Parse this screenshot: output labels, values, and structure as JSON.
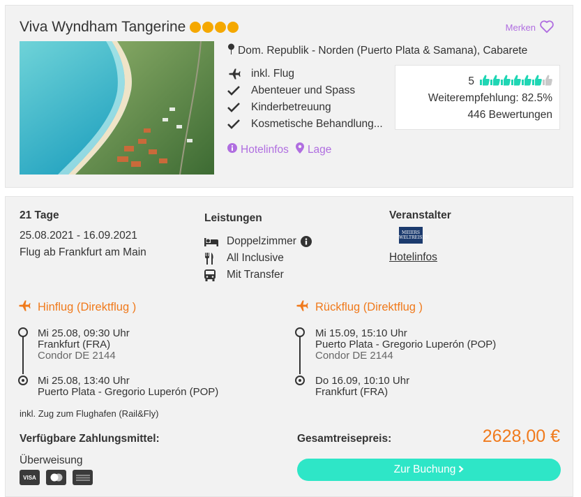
{
  "hotel": {
    "name": "Viva Wyndham Tangerine",
    "stars": 4,
    "merken_label": "Merken",
    "location": "Dom. Republik - Norden (Puerto Plata & Samana), Cabarete",
    "features": [
      {
        "icon": "plane-icon",
        "label": "inkl. Flug"
      },
      {
        "icon": "check-icon",
        "label": "Abenteuer und Spass"
      },
      {
        "icon": "check-icon",
        "label": "Kinderbetreuung"
      },
      {
        "icon": "check-icon",
        "label": "Kosmetische Behandlung..."
      }
    ],
    "rating": {
      "score": "5",
      "thumbs_filled": 6,
      "thumbs_total": 7,
      "recommend": "Weiterempfehlung: 82.5%",
      "reviews": "446 Bewertungen"
    },
    "links": {
      "hotelinfos": "Hotelinfos",
      "lage": "Lage"
    }
  },
  "trip": {
    "duration": "21 Tage",
    "dates": "25.08.2021 - 16.09.2021",
    "departure": "Flug ab Frankfurt am Main",
    "leistungen_label": "Leistungen",
    "leistungen": [
      {
        "icon": "bed-icon",
        "label": "Doppelzimmer"
      },
      {
        "icon": "cutlery-icon",
        "label": "All Inclusive"
      },
      {
        "icon": "bus-icon",
        "label": "Mit Transfer"
      }
    ],
    "veranstalter_label": "Veranstalter",
    "veranstalter_logo_text": "MEIERS WELTREISEN",
    "veranstalter_link": "Hotelinfos"
  },
  "hinflug": {
    "title": "Hinflug (Direktflug )",
    "dep_time": "Mi 25.08, 09:30 Uhr",
    "dep_airport": "Frankfurt (FRA)",
    "carrier": "Condor DE 2144",
    "arr_time": "Mi 25.08, 13:40 Uhr",
    "arr_airport": "Puerto Plata - Gregorio Luperón (POP)"
  },
  "rueckflug": {
    "title": "Rückflug (Direktflug )",
    "dep_time": "Mi 15.09, 15:10 Uhr",
    "dep_airport": "Puerto Plata - Gregorio Luperón (POP)",
    "carrier": "Condor DE 2144",
    "arr_time": "Do 16.09, 10:10 Uhr",
    "arr_airport": "Frankfurt (FRA)"
  },
  "rail_note": "inkl. Zug zum Flughafen (Rail&Fly)",
  "payment": {
    "label": "Verfügbare Zahlungsmittel:",
    "method": "Überweisung",
    "cards": [
      {
        "icon": "visa-icon",
        "text": "VISA"
      },
      {
        "icon": "mastercard-icon",
        "text": ""
      },
      {
        "icon": "amex-icon",
        "text": ""
      }
    ]
  },
  "total": {
    "label": "Gesamtreisepreis:",
    "price": "2628,00 €",
    "button": "Zur Buchung"
  },
  "colors": {
    "accent_orange": "#f07a1c",
    "accent_purple": "#b06ee0",
    "button_teal": "#2ee6c7",
    "star_gold": "#f5a800",
    "thumb_teal": "#1fd6b4"
  }
}
